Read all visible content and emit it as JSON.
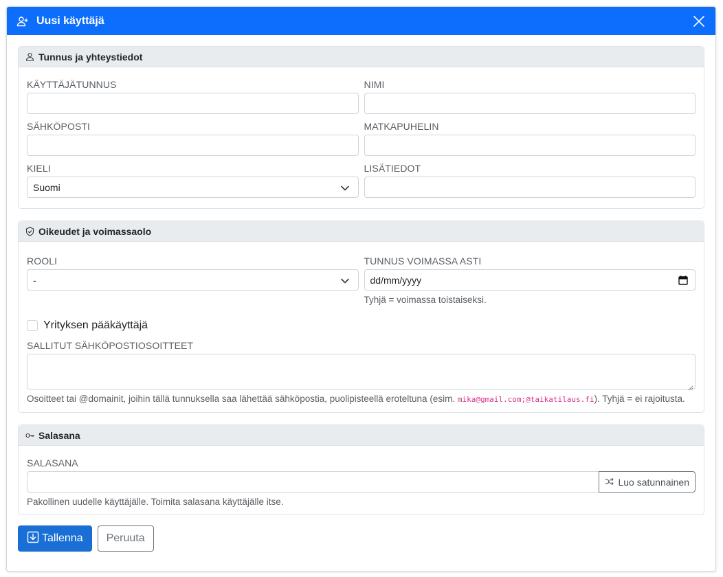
{
  "dialog": {
    "title": "Uusi käyttäjä",
    "title_icon": "person-plus-icon",
    "close_icon": "close-icon"
  },
  "colors": {
    "accent": "#0d6efd",
    "primary_button": "#1a6fd6",
    "code_text": "#d63384"
  },
  "sections": {
    "identity": {
      "title": "Tunnus ja yhteystiedot",
      "icon": "person-icon",
      "fields": {
        "username": {
          "label": "KÄYTTÄJÄTUNNUS",
          "value": ""
        },
        "name": {
          "label": "NIMI",
          "value": ""
        },
        "email": {
          "label": "SÄHKÖPOSTI",
          "value": ""
        },
        "mobile": {
          "label": "MATKAPUHELIN",
          "value": ""
        },
        "language": {
          "label": "KIELI",
          "value": "Suomi"
        },
        "info": {
          "label": "LISÄTIEDOT",
          "value": ""
        }
      }
    },
    "rights": {
      "title": "Oikeudet ja voimassaolo",
      "icon": "shield-check-icon",
      "role": {
        "label": "ROOLI",
        "value": "-"
      },
      "valid_until": {
        "label": "TUNNUS VOIMASSA ASTI",
        "placeholder": "dd/mm/yyyy",
        "help": "Tyhjä = voimassa toistaiseksi."
      },
      "company_admin": {
        "label": "Yrityksen pääkäyttäjä",
        "checked": false
      },
      "allowed_emails": {
        "label": "SALLITUT SÄHKÖPOSTIOSOITTEET",
        "value": "",
        "help_before": "Osoitteet tai @domainit, joihin tällä tunnuksella saa lähettää sähköpostia, puolipisteellä eroteltuna (esim. ",
        "help_code": "mika@gmail.com;@taikatilaus.fi",
        "help_after": "). Tyhjä = ei rajoitusta."
      }
    },
    "password": {
      "title": "Salasana",
      "icon": "key-icon",
      "field": {
        "label": "SALASANA",
        "value": ""
      },
      "generate_button": "Luo satunnainen",
      "generate_icon": "shuffle-icon",
      "help": "Pakollinen uudelle käyttäjälle. Toimita salasana käyttäjälle itse."
    }
  },
  "footer": {
    "save_label": "Tallenna",
    "save_icon": "save-download-icon",
    "cancel_label": "Peruuta"
  }
}
